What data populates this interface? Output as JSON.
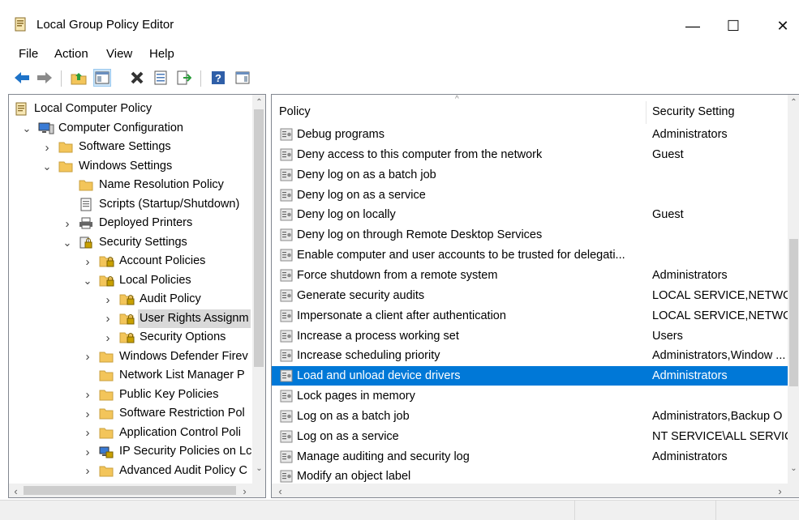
{
  "window": {
    "title": "Local Group Policy Editor",
    "minimize": "—",
    "maximize": "☐",
    "close": "✕"
  },
  "menu": [
    "File",
    "Action",
    "View",
    "Help"
  ],
  "tree": [
    {
      "label": "Local Computer Policy",
      "indent": 0,
      "expander": "",
      "icon": "policy"
    },
    {
      "label": "Computer Configuration",
      "indent": 1,
      "expander": "open",
      "icon": "computer"
    },
    {
      "label": "Software Settings",
      "indent": 2,
      "expander": "closed",
      "icon": "folder"
    },
    {
      "label": "Windows Settings",
      "indent": 2,
      "expander": "open",
      "icon": "folder"
    },
    {
      "label": "Name Resolution Policy",
      "indent": 3,
      "expander": "",
      "icon": "folder"
    },
    {
      "label": "Scripts (Startup/Shutdown)",
      "indent": 3,
      "expander": "",
      "icon": "script"
    },
    {
      "label": "Deployed Printers",
      "indent": 3,
      "expander": "closed",
      "icon": "printer"
    },
    {
      "label": "Security Settings",
      "indent": 3,
      "expander": "open",
      "icon": "security"
    },
    {
      "label": "Account Policies",
      "indent": 4,
      "expander": "closed",
      "icon": "lockfolder"
    },
    {
      "label": "Local Policies",
      "indent": 4,
      "expander": "open",
      "icon": "lockfolder"
    },
    {
      "label": "Audit Policy",
      "indent": 5,
      "expander": "closed",
      "icon": "lockfolder"
    },
    {
      "label": "User Rights Assignm",
      "indent": 5,
      "expander": "closed",
      "icon": "lockfolder",
      "selected": true
    },
    {
      "label": "Security Options",
      "indent": 5,
      "expander": "closed",
      "icon": "lockfolder"
    },
    {
      "label": "Windows Defender Firev",
      "indent": 4,
      "expander": "closed",
      "icon": "folder"
    },
    {
      "label": "Network List Manager P",
      "indent": 4,
      "expander": "",
      "icon": "folder"
    },
    {
      "label": "Public Key Policies",
      "indent": 4,
      "expander": "closed",
      "icon": "folder"
    },
    {
      "label": "Software Restriction Pol",
      "indent": 4,
      "expander": "closed",
      "icon": "folder"
    },
    {
      "label": "Application Control Poli",
      "indent": 4,
      "expander": "closed",
      "icon": "folder"
    },
    {
      "label": "IP Security Policies on Lc",
      "indent": 4,
      "expander": "closed",
      "icon": "ipsec"
    },
    {
      "label": "Advanced Audit Policy C",
      "indent": 4,
      "expander": "closed",
      "icon": "folder"
    }
  ],
  "list": {
    "columns": {
      "policy": "Policy",
      "setting": "Security Setting"
    },
    "rows": [
      {
        "policy": "Debug programs",
        "setting": "Administrators"
      },
      {
        "policy": "Deny access to this computer from the network",
        "setting": "Guest"
      },
      {
        "policy": "Deny log on as a batch job",
        "setting": ""
      },
      {
        "policy": "Deny log on as a service",
        "setting": ""
      },
      {
        "policy": "Deny log on locally",
        "setting": "Guest"
      },
      {
        "policy": "Deny log on through Remote Desktop Services",
        "setting": ""
      },
      {
        "policy": "Enable computer and user accounts to be trusted for delegati...",
        "setting": ""
      },
      {
        "policy": "Force shutdown from a remote system",
        "setting": "Administrators"
      },
      {
        "policy": "Generate security audits",
        "setting": "LOCAL SERVICE,NETWOR"
      },
      {
        "policy": "Impersonate a client after authentication",
        "setting": "LOCAL SERVICE,NETWOR"
      },
      {
        "policy": "Increase a process working set",
        "setting": "Users"
      },
      {
        "policy": "Increase scheduling priority",
        "setting": "Administrators,Window ..."
      },
      {
        "policy": "Load and unload device drivers",
        "setting": "Administrators",
        "selected": true
      },
      {
        "policy": "Lock pages in memory",
        "setting": ""
      },
      {
        "policy": "Log on as a batch job",
        "setting": "Administrators,Backup O"
      },
      {
        "policy": "Log on as a service",
        "setting": "NT SERVICE\\ALL SERVICES"
      },
      {
        "policy": "Manage auditing and security log",
        "setting": "Administrators"
      },
      {
        "policy": "Modify an object label",
        "setting": ""
      }
    ]
  },
  "toolbar_icons": [
    "back-arrow-icon",
    "forward-arrow-icon",
    "up-folder-icon",
    "show-hide-tree-icon",
    "delete-icon",
    "properties-icon",
    "export-list-icon",
    "help-icon",
    "show-hide-action-pane-icon"
  ],
  "colors": {
    "selection": "#0078d7",
    "folder": "#f3c55a",
    "accent_blue": "#1e73c8"
  }
}
